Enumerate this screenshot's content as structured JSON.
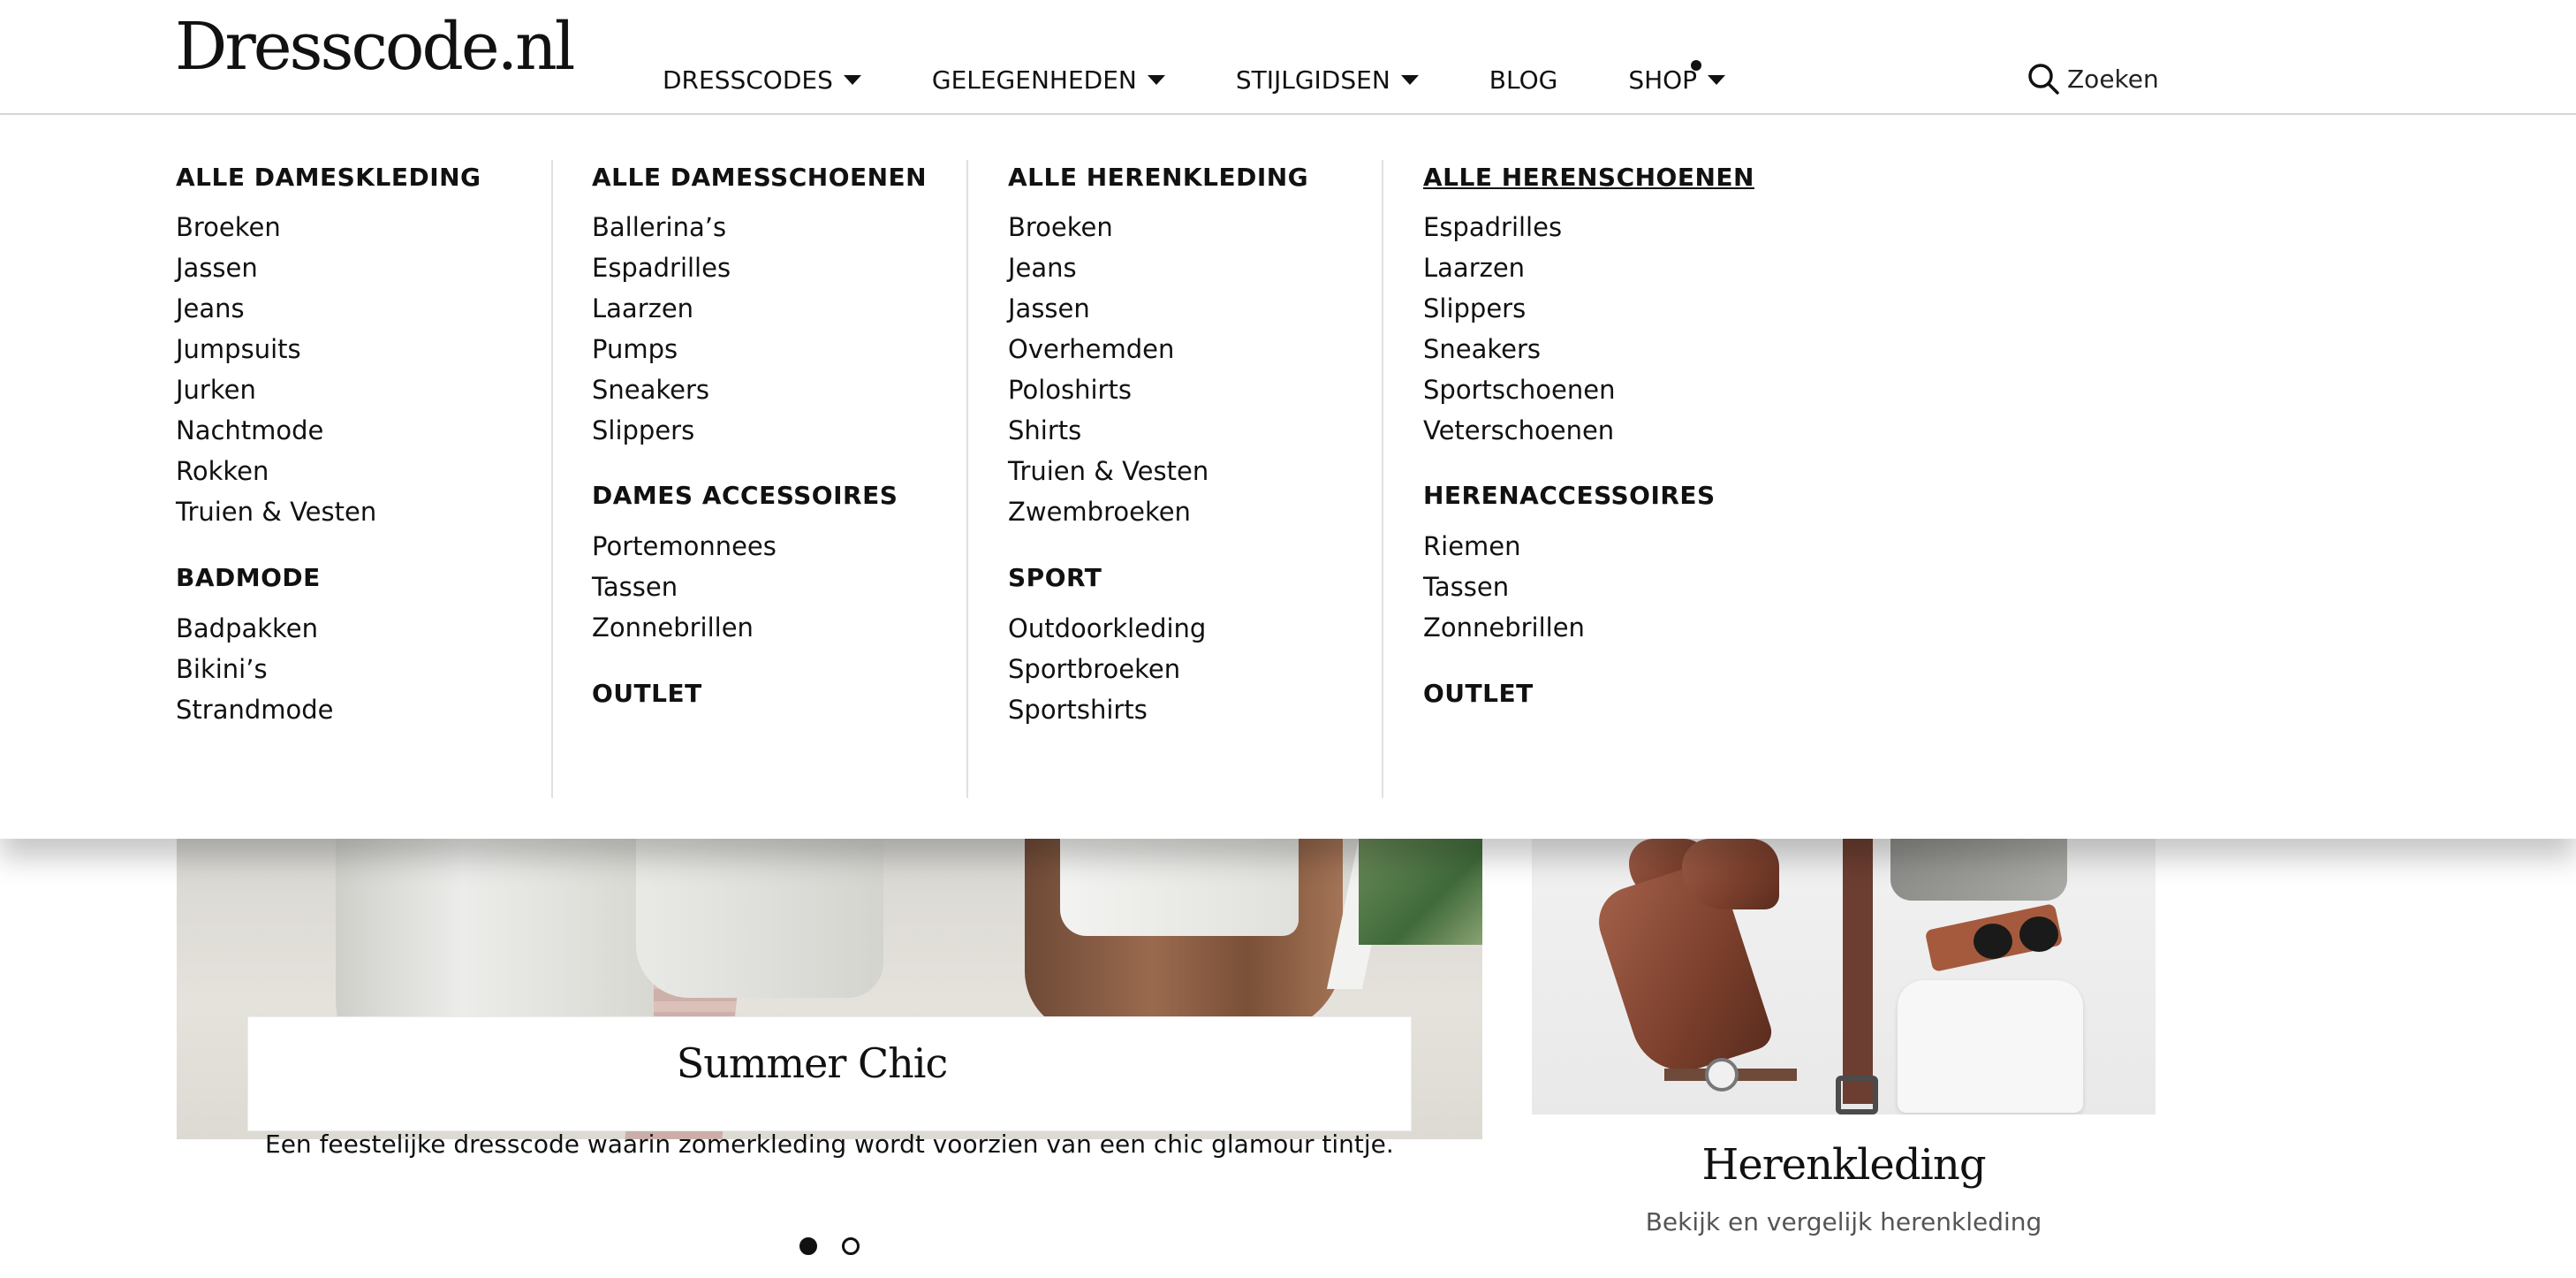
{
  "header": {
    "logo": "Dresscode.nl",
    "nav": [
      {
        "label": "DRESSCODES",
        "has_dropdown": true
      },
      {
        "label": "GELEGENHEDEN",
        "has_dropdown": true
      },
      {
        "label": "STIJLGIDSEN",
        "has_dropdown": true
      },
      {
        "label": "BLOG",
        "has_dropdown": false
      },
      {
        "label": "SHOP",
        "has_dropdown": true
      }
    ],
    "search_label": "Zoeken"
  },
  "mega_menu": {
    "columns": [
      {
        "sections": [
          {
            "heading": "ALLE DAMESKLEDING",
            "items": [
              "Broeken",
              "Jassen",
              "Jeans",
              "Jumpsuits",
              "Jurken",
              "Nachtmode",
              "Rokken",
              "Truien & Vesten"
            ]
          },
          {
            "heading": "BADMODE",
            "items": [
              "Badpakken",
              "Bikini’s",
              "Strandmode"
            ]
          }
        ]
      },
      {
        "sections": [
          {
            "heading": "ALLE DAMESSCHOENEN",
            "items": [
              "Ballerina’s",
              "Espadrilles",
              "Laarzen",
              "Pumps",
              "Sneakers",
              "Slippers"
            ]
          },
          {
            "heading": "DAMES ACCESSOIRES",
            "items": [
              "Portemonnees",
              "Tassen",
              "Zonnebrillen"
            ]
          },
          {
            "heading": "OUTLET",
            "items": []
          }
        ]
      },
      {
        "sections": [
          {
            "heading": "ALLE HERENKLEDING",
            "items": [
              "Broeken",
              "Jeans",
              "Jassen",
              "Overhemden",
              "Poloshirts",
              "Shirts",
              "Truien & Vesten",
              "Zwembroeken"
            ]
          },
          {
            "heading": "SPORT",
            "items": [
              "Outdoorkleding",
              "Sportbroeken",
              "Sportshirts"
            ]
          }
        ]
      },
      {
        "sections": [
          {
            "heading": "ALLE HERENSCHOENEN",
            "hovered": true,
            "items": [
              "Espadrilles",
              "Laarzen",
              "Slippers",
              "Sneakers",
              "Sportschoenen",
              "Veterschoenen"
            ]
          },
          {
            "heading": "HERENACCESSOIRES",
            "items": [
              "Riemen",
              "Tassen",
              "Zonnebrillen"
            ]
          },
          {
            "heading": "OUTLET",
            "items": []
          }
        ]
      }
    ]
  },
  "hero": {
    "title": "Summer Chic",
    "description": "Een feestelijke dresscode waarin zomerkleding wordt voorzien van een chic glamour tintje.",
    "carousel": {
      "slides": 2,
      "active": 1
    }
  },
  "promo": {
    "title": "Herenkleding",
    "subtitle": "Bekijk en vergelijk herenkleding"
  }
}
